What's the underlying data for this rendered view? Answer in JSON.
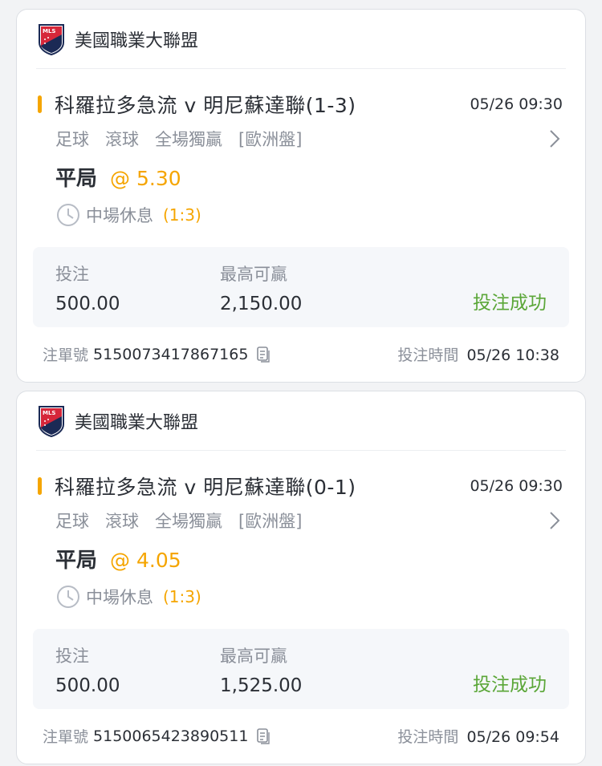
{
  "colors": {
    "accent": "#f5a500",
    "success": "#5aa637",
    "muted_text": "#8a8f99",
    "primary_text": "#2b2f36",
    "logo_red": "#d6273a",
    "logo_navy": "#1b2a55"
  },
  "cards": [
    {
      "league": {
        "name": "美國職業大聯盟",
        "logo_text": "MLS"
      },
      "match": {
        "title": "科羅拉多急流 v 明尼蘇達聯(1-3)",
        "time": "05/26 09:30"
      },
      "tags": [
        "足球",
        "滾球",
        "全場獨贏",
        "[歐洲盤]"
      ],
      "pick": {
        "name": "平局",
        "odds": "@ 5.30"
      },
      "status": {
        "text": "中場休息",
        "score": "(1:3)"
      },
      "bet": {
        "stake_label": "投注",
        "stake_value": "500.00",
        "max_win_label": "最高可贏",
        "max_win_value": "2,150.00",
        "status": "投注成功"
      },
      "footer": {
        "order_label": "注單號",
        "order_number": "5150073417867165",
        "time_label": "投注時間",
        "time_value": "05/26 10:38"
      }
    },
    {
      "league": {
        "name": "美國職業大聯盟",
        "logo_text": "MLS"
      },
      "match": {
        "title": "科羅拉多急流 v 明尼蘇達聯(0-1)",
        "time": "05/26 09:30"
      },
      "tags": [
        "足球",
        "滾球",
        "全場獨贏",
        "[歐洲盤]"
      ],
      "pick": {
        "name": "平局",
        "odds": "@ 4.05"
      },
      "status": {
        "text": "中場休息",
        "score": "(1:3)"
      },
      "bet": {
        "stake_label": "投注",
        "stake_value": "500.00",
        "max_win_label": "最高可贏",
        "max_win_value": "1,525.00",
        "status": "投注成功"
      },
      "footer": {
        "order_label": "注單號",
        "order_number": "5150065423890511",
        "time_label": "投注時間",
        "time_value": "05/26 09:54"
      }
    }
  ]
}
